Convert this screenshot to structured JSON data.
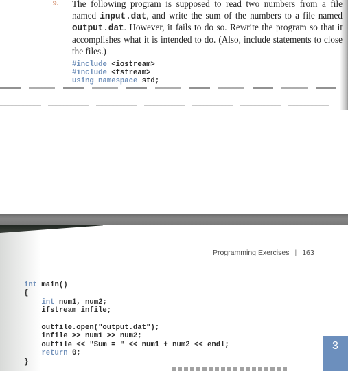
{
  "top_page": {
    "question_number": "9.",
    "question_parts": [
      {
        "text": "The following program is supposed to read two numbers from a file named ",
        "mono": false
      },
      {
        "text": "input.dat",
        "mono": true
      },
      {
        "text": ", and write the sum of the numbers to a file named ",
        "mono": false
      },
      {
        "text": "output.dat",
        "mono": true
      },
      {
        "text": ". However, it fails to do so. Rewrite the program so that it accomplishes what it is intended to do. (Also, include statements to close the files.)",
        "mono": false
      }
    ],
    "code_lines": [
      [
        {
          "t": "#include",
          "kw": true
        },
        {
          "t": " <iostream>",
          "kw": false
        }
      ],
      [
        {
          "t": "#include",
          "kw": true
        },
        {
          "t": " <fstream>",
          "kw": false
        }
      ],
      [
        {
          "t": "using namespace",
          "kw": true
        },
        {
          "t": " std;",
          "kw": false
        }
      ]
    ]
  },
  "bottom_page": {
    "running_head": {
      "section": "Programming Exercises",
      "separator": "|",
      "page_number": "163"
    },
    "code_lines": [
      [
        {
          "t": "int",
          "kw": true
        },
        {
          "t": " main()",
          "kw": false
        }
      ],
      [
        {
          "t": "{",
          "kw": false
        }
      ],
      [
        {
          "t": "    ",
          "kw": false
        },
        {
          "t": "int",
          "kw": true
        },
        {
          "t": " num1, num2;",
          "kw": false
        }
      ],
      [
        {
          "t": "    ifstream infile;",
          "kw": false
        }
      ],
      [
        {
          "t": "",
          "kw": false
        }
      ],
      [
        {
          "t": "    outfile.open(\"output.dat\");",
          "kw": false
        }
      ],
      [
        {
          "t": "    infile >> num1 >> num2;",
          "kw": false
        }
      ],
      [
        {
          "t": "    outfile << \"Sum = \" << num1 + num2 << endl;",
          "kw": false
        }
      ],
      [
        {
          "t": "    ",
          "kw": false
        },
        {
          "t": "return",
          "kw": true
        },
        {
          "t": " 0;",
          "kw": false
        }
      ],
      [
        {
          "t": "}",
          "kw": false
        }
      ]
    ],
    "chapter_tab": "3",
    "colors": {
      "chapter_tab": "#6c8fbd",
      "keyword": "#6f8fb9",
      "question_number": "#c8744a"
    }
  }
}
